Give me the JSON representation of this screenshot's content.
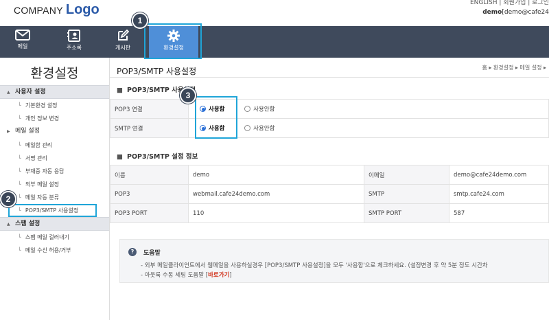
{
  "header": {
    "company": "COMPANY",
    "logo": "Logo",
    "top_links": "ENGLISH  |  회원가입  |  로그인",
    "user_name": "demo",
    "user_email": "[demo@cafe24"
  },
  "nav": {
    "items": [
      {
        "label": "메일",
        "icon": "mail-icon"
      },
      {
        "label": "주소록",
        "icon": "address-book-icon"
      },
      {
        "label": "게시판",
        "icon": "edit-icon"
      },
      {
        "label": "환경설정",
        "icon": "gear-icon",
        "active": true
      }
    ]
  },
  "sidebar": {
    "title": "환경설정",
    "groups": [
      {
        "label": "사용자 설정",
        "expanded": true,
        "items": [
          "기본환경 설정",
          "개인 정보 변경"
        ]
      },
      {
        "label": "메일 설정",
        "expanded": false,
        "items": [
          "메일함 관리",
          "서명 관리",
          "부재중 자동 응답",
          "외부 메일 설정",
          "메일 자동 분류",
          "POP3/SMTP 사용설정"
        ]
      },
      {
        "label": "스팸 설정",
        "expanded": true,
        "items": [
          "스팸 메일 걸러내기",
          "메일 수신 허용/거부"
        ]
      }
    ],
    "selected": "POP3/SMTP 사용설정"
  },
  "content": {
    "page_title": "POP3/SMTP 사용설정",
    "breadcrumb": "홈 ▸ 환경설정 ▸ 메일 설정 ▸",
    "section1_title": "POP3/SMTP 사용설정",
    "rows1": [
      {
        "label": "POP3 연결",
        "on": "사용함",
        "off": "사용안함"
      },
      {
        "label": "SMTP 연결",
        "on": "사용함",
        "off": "사용안함"
      }
    ],
    "section2_title": "POP3/SMTP 설정 정보",
    "info": [
      [
        "이름",
        "demo",
        "이메일",
        "demo@cafe24demo.com"
      ],
      [
        "POP3",
        "webmail.cafe24demo.com",
        "SMTP",
        "smtp.cafe24.com"
      ],
      [
        "POP3 PORT",
        "110",
        "SMTP PORT",
        "587"
      ]
    ]
  },
  "help": {
    "title": "도움말",
    "line1": "- 외부 메일클라이언트에서 웹메일을 사용하실경우 [POP3/SMTP 사용설정]을 모두 '사용함'으로 체크하세요. (설정변경 후 약 5분 정도 시간차",
    "line2_prefix": "- 아웃룩 수동 세팅 도움말 [",
    "line2_link": "바로가기",
    "line2_suffix": "]"
  },
  "badges": [
    "1",
    "2",
    "3"
  ],
  "colors": {
    "nav_bg": "#3f4a5c",
    "nav_active": "#4f8fd8",
    "highlight": "#1fa5d8",
    "logo": "#2b5aa8",
    "link": "#d2361f"
  }
}
